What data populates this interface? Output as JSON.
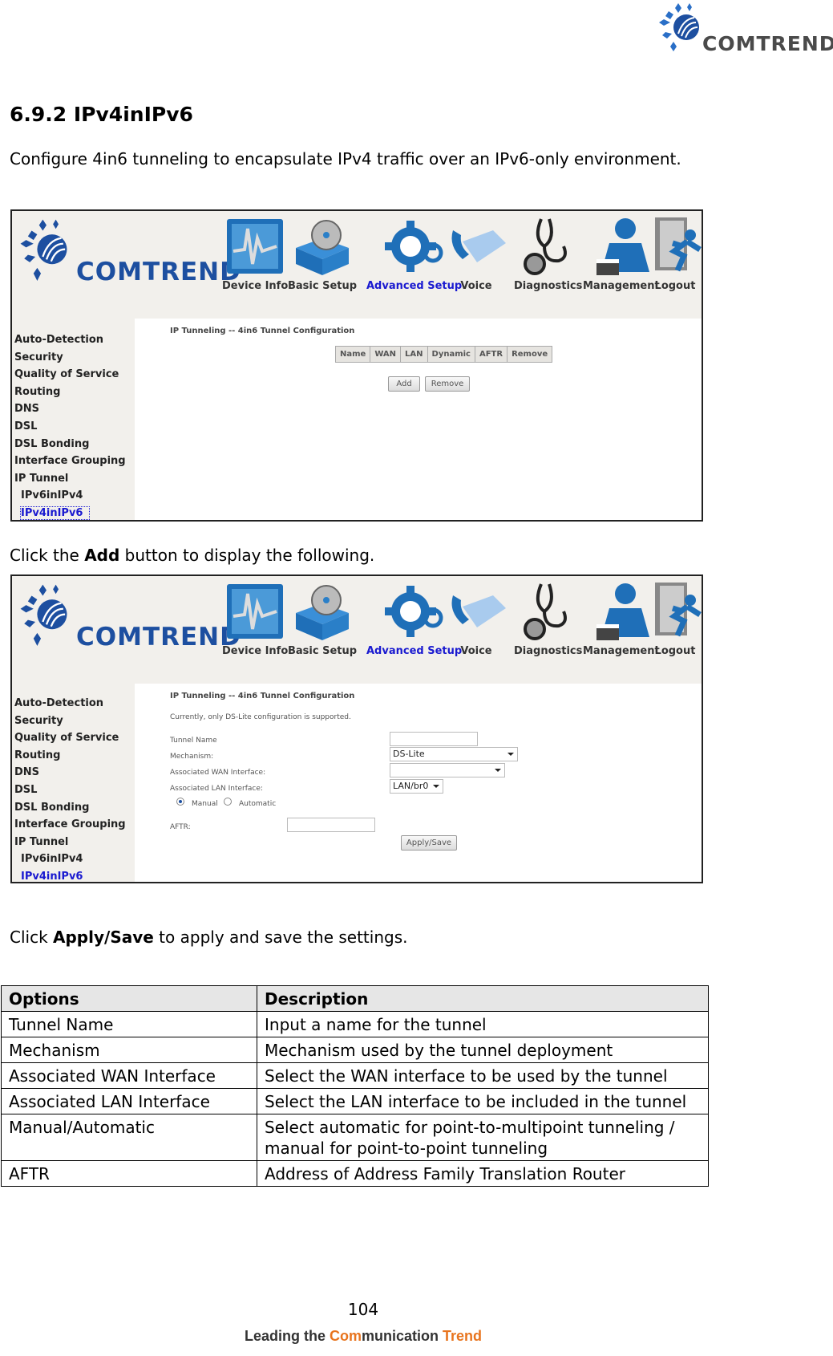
{
  "page_logo": {
    "text": "COMTREND",
    "icon": "comtrend-logo-icon"
  },
  "heading": "6.9.2 IPv4inIPv6",
  "intro": "Configure 4in6 tunneling to encapsulate IPv4 traffic over an IPv6-only environment.",
  "click_add": {
    "pre": "Click the ",
    "bold": "Add",
    "post": " button to display the following."
  },
  "click_apply": {
    "pre": "Click ",
    "bold": "Apply/Save",
    "post": " to apply and save the settings."
  },
  "router_ui": {
    "brand": "COMTREND",
    "nav": [
      {
        "label": "Device Info",
        "icon": "device-info-icon",
        "active": false
      },
      {
        "label": "Basic Setup",
        "icon": "basic-setup-icon",
        "active": false
      },
      {
        "label": "Advanced Setup",
        "icon": "advanced-setup-gear-icon",
        "active": true
      },
      {
        "label": "Voice",
        "icon": "voice-phone-icon",
        "active": false
      },
      {
        "label": "Diagnostics",
        "icon": "diagnostics-stethoscope-icon",
        "active": false
      },
      {
        "label": "Management",
        "icon": "management-user-icon",
        "active": false
      },
      {
        "label": "Logout",
        "icon": "logout-running-man-icon",
        "active": false
      }
    ],
    "sidebar": [
      {
        "label": "Auto-Detection"
      },
      {
        "label": "Security"
      },
      {
        "label": "Quality of Service"
      },
      {
        "label": "Routing"
      },
      {
        "label": "DNS"
      },
      {
        "label": "DSL"
      },
      {
        "label": "DSL Bonding"
      },
      {
        "label": "Interface Grouping"
      },
      {
        "label": "IP Tunnel"
      },
      {
        "label": "IPv6inIPv4"
      },
      {
        "label": "IPv4inIPv6"
      }
    ]
  },
  "screen1": {
    "title": "IP Tunneling -- 4in6 Tunnel Configuration",
    "columns": [
      "Name",
      "WAN",
      "LAN",
      "Dynamic",
      "AFTR",
      "Remove"
    ],
    "add_label": "Add",
    "remove_label": "Remove"
  },
  "screen2": {
    "title": "IP Tunneling -- 4in6 Tunnel Configuration",
    "note": "Currently, only DS-Lite configuration is supported.",
    "tunnel_name_label": "Tunnel Name",
    "tunnel_name_value": "",
    "mechanism_label": "Mechanism:",
    "mechanism_value": "DS-Lite",
    "wan_label": "Associated WAN Interface:",
    "wan_value": "",
    "lan_label": "Associated LAN Interface:",
    "lan_value": "LAN/br0",
    "radio_manual": "Manual",
    "radio_automatic": "Automatic",
    "radio_selected": "Manual",
    "aftr_label": "AFTR:",
    "aftr_value": "",
    "apply_label": "Apply/Save"
  },
  "options_table": {
    "headers": [
      "Options",
      "Description"
    ],
    "rows": [
      [
        "Tunnel Name",
        "Input a name for the tunnel"
      ],
      [
        "Mechanism",
        "Mechanism used by the tunnel deployment"
      ],
      [
        "Associated WAN Interface",
        "Select the WAN interface to be used by the tunnel"
      ],
      [
        "Associated LAN Interface",
        "Select the LAN interface to be included in the tunnel"
      ],
      [
        "Manual/Automatic",
        "Select automatic for point-to-multipoint tunneling / manual for point-to-point tunneling"
      ],
      [
        "AFTR",
        "Address of Address Family Translation Router"
      ]
    ]
  },
  "footer": {
    "page_number": "104",
    "tagline_1": "Leading the ",
    "tagline_2": "Com",
    "tagline_3": "munication ",
    "tagline_4": "Trend"
  }
}
